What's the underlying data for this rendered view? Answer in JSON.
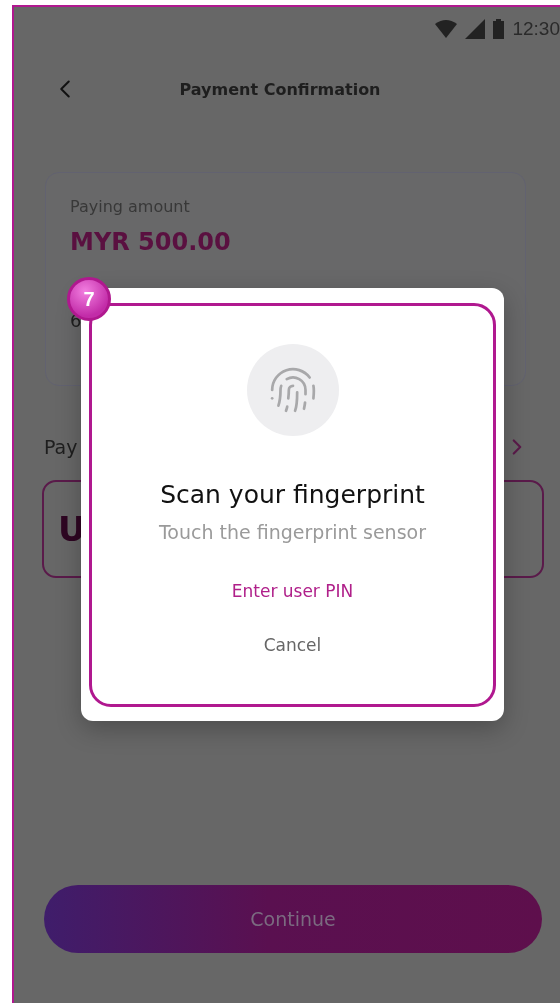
{
  "status_bar": {
    "time": "12:30"
  },
  "header": {
    "title": "Payment Confirmation"
  },
  "amount_card": {
    "label": "Paying amount",
    "amount": "MYR 500.00",
    "column_3": "6"
  },
  "payment_section": {
    "label": "Pay",
    "box_text": "U"
  },
  "continue_button": {
    "label": "Continue"
  },
  "dialog": {
    "title": "Scan your fingerprint",
    "subtitle": "Touch the fingerprint sensor",
    "pin_link": "Enter user PIN",
    "cancel": "Cancel"
  },
  "annotation": {
    "number": "7"
  }
}
